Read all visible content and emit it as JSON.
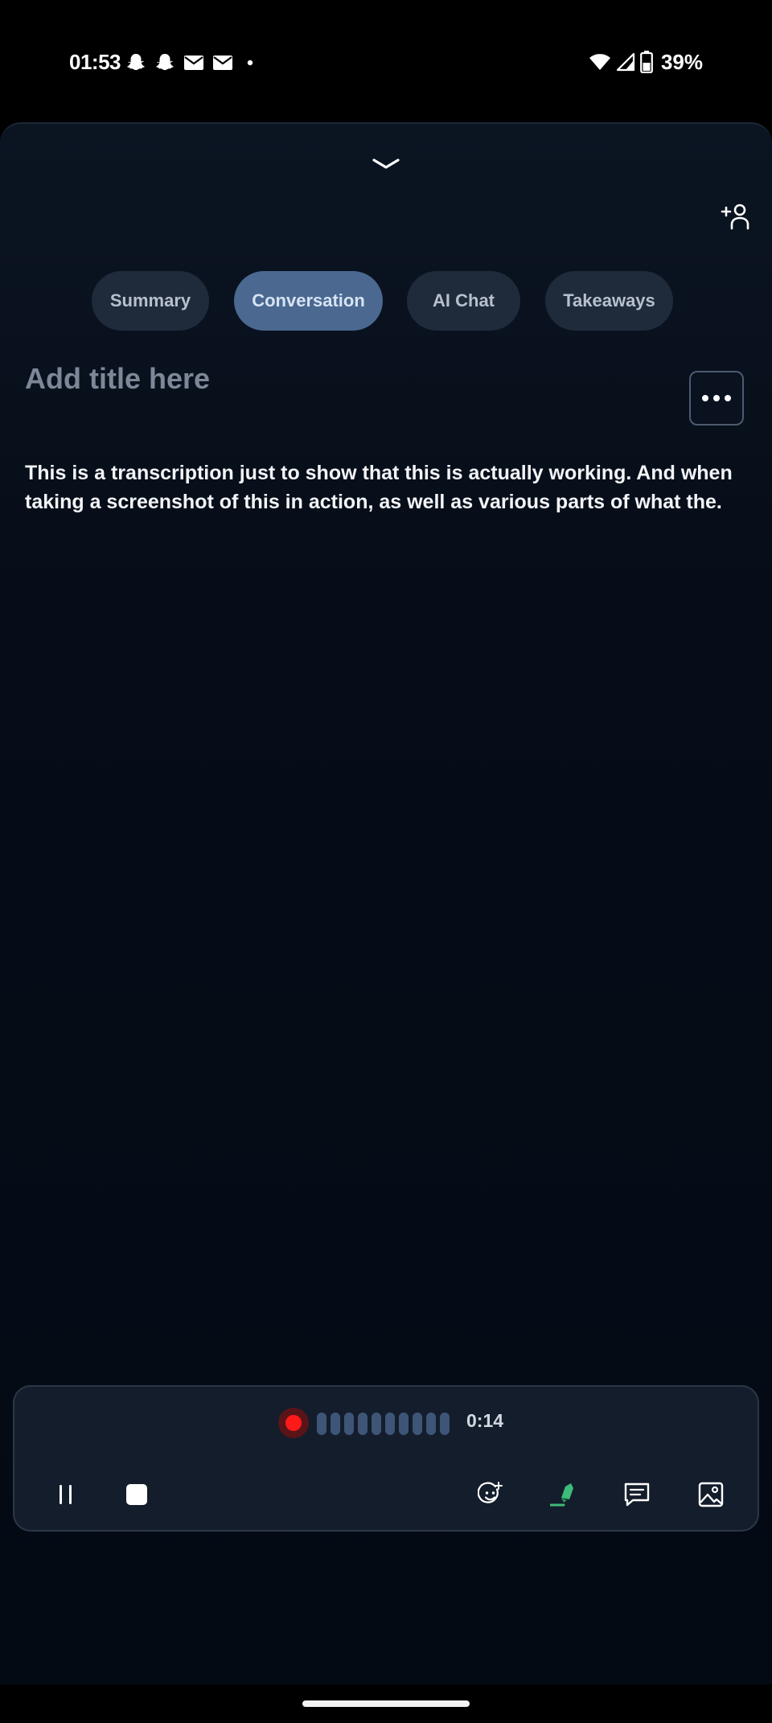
{
  "status_bar": {
    "time": "01:53",
    "notification_icons": [
      "snapchat-icon",
      "snapchat-icon",
      "mail-icon",
      "mail-icon",
      "more-notifications-dot-icon"
    ],
    "battery_percent": "39%"
  },
  "tabs": [
    {
      "label": "Summary",
      "active": false
    },
    {
      "label": "Conversation",
      "active": true
    },
    {
      "label": "AI Chat",
      "active": false
    },
    {
      "label": "Takeaways",
      "active": false
    }
  ],
  "note": {
    "title_placeholder": "Add title here",
    "transcript": "This is a transcription just to show that this is actually working. And when taking a screenshot of this in action, as well as various parts of what the."
  },
  "recorder": {
    "elapsed": "0:14",
    "level_bar_count": 10
  },
  "colors": {
    "accent_tab": "#4a6890",
    "recording_red": "#ff1a1a",
    "highlighter_green": "#3dbb7a"
  }
}
